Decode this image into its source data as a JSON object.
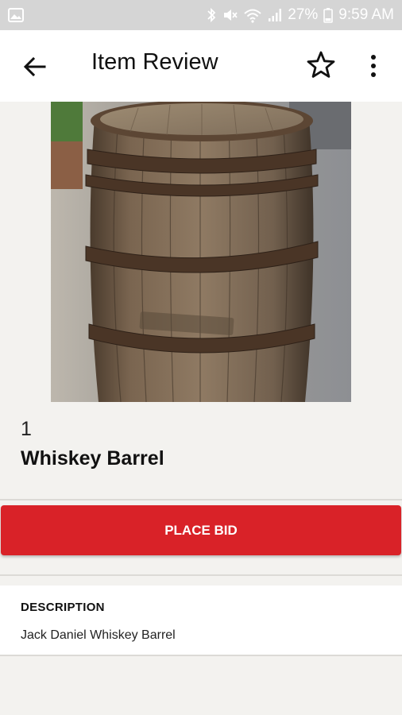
{
  "status_bar": {
    "battery": "27%",
    "time": "9:59 AM",
    "icons": [
      "image-icon",
      "bluetooth-icon",
      "mute-icon",
      "wifi-icon",
      "signal-icon",
      "battery-icon"
    ]
  },
  "app_bar": {
    "title": "Item Review",
    "icons": [
      "back-arrow-icon",
      "star-icon",
      "more-vert-icon"
    ]
  },
  "item": {
    "lot_number": "1",
    "name": "Whiskey Barrel",
    "image": "whiskey-barrel-photo"
  },
  "actions": {
    "place_bid_label": "PLACE BID",
    "accent_color": "#d92228"
  },
  "description": {
    "heading": "DESCRIPTION",
    "text": "Jack Daniel Whiskey Barrel"
  }
}
